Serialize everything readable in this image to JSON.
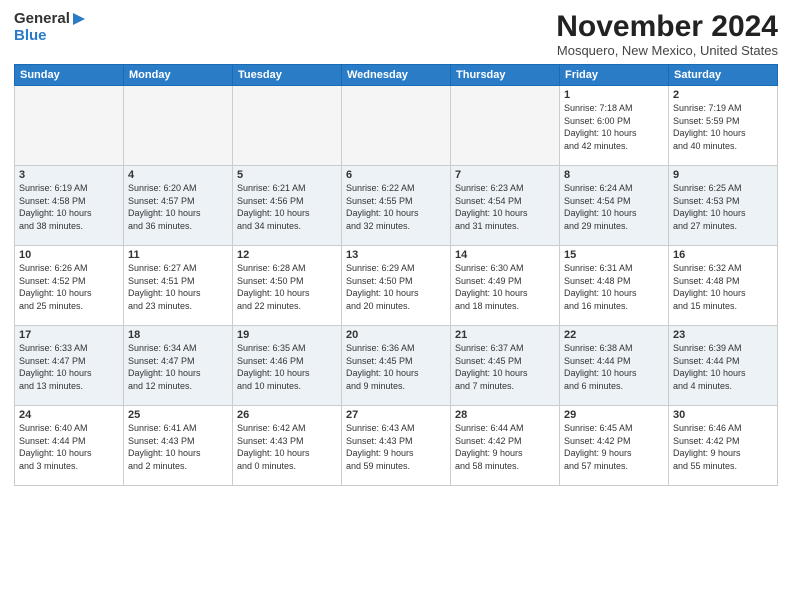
{
  "header": {
    "logo_line1": "General",
    "logo_line2": "Blue",
    "month": "November 2024",
    "location": "Mosquero, New Mexico, United States"
  },
  "weekdays": [
    "Sunday",
    "Monday",
    "Tuesday",
    "Wednesday",
    "Thursday",
    "Friday",
    "Saturday"
  ],
  "weeks": [
    [
      {
        "day": "",
        "info": ""
      },
      {
        "day": "",
        "info": ""
      },
      {
        "day": "",
        "info": ""
      },
      {
        "day": "",
        "info": ""
      },
      {
        "day": "",
        "info": ""
      },
      {
        "day": "1",
        "info": "Sunrise: 7:18 AM\nSunset: 6:00 PM\nDaylight: 10 hours\nand 42 minutes."
      },
      {
        "day": "2",
        "info": "Sunrise: 7:19 AM\nSunset: 5:59 PM\nDaylight: 10 hours\nand 40 minutes."
      }
    ],
    [
      {
        "day": "3",
        "info": "Sunrise: 6:19 AM\nSunset: 4:58 PM\nDaylight: 10 hours\nand 38 minutes."
      },
      {
        "day": "4",
        "info": "Sunrise: 6:20 AM\nSunset: 4:57 PM\nDaylight: 10 hours\nand 36 minutes."
      },
      {
        "day": "5",
        "info": "Sunrise: 6:21 AM\nSunset: 4:56 PM\nDaylight: 10 hours\nand 34 minutes."
      },
      {
        "day": "6",
        "info": "Sunrise: 6:22 AM\nSunset: 4:55 PM\nDaylight: 10 hours\nand 32 minutes."
      },
      {
        "day": "7",
        "info": "Sunrise: 6:23 AM\nSunset: 4:54 PM\nDaylight: 10 hours\nand 31 minutes."
      },
      {
        "day": "8",
        "info": "Sunrise: 6:24 AM\nSunset: 4:54 PM\nDaylight: 10 hours\nand 29 minutes."
      },
      {
        "day": "9",
        "info": "Sunrise: 6:25 AM\nSunset: 4:53 PM\nDaylight: 10 hours\nand 27 minutes."
      }
    ],
    [
      {
        "day": "10",
        "info": "Sunrise: 6:26 AM\nSunset: 4:52 PM\nDaylight: 10 hours\nand 25 minutes."
      },
      {
        "day": "11",
        "info": "Sunrise: 6:27 AM\nSunset: 4:51 PM\nDaylight: 10 hours\nand 23 minutes."
      },
      {
        "day": "12",
        "info": "Sunrise: 6:28 AM\nSunset: 4:50 PM\nDaylight: 10 hours\nand 22 minutes."
      },
      {
        "day": "13",
        "info": "Sunrise: 6:29 AM\nSunset: 4:50 PM\nDaylight: 10 hours\nand 20 minutes."
      },
      {
        "day": "14",
        "info": "Sunrise: 6:30 AM\nSunset: 4:49 PM\nDaylight: 10 hours\nand 18 minutes."
      },
      {
        "day": "15",
        "info": "Sunrise: 6:31 AM\nSunset: 4:48 PM\nDaylight: 10 hours\nand 16 minutes."
      },
      {
        "day": "16",
        "info": "Sunrise: 6:32 AM\nSunset: 4:48 PM\nDaylight: 10 hours\nand 15 minutes."
      }
    ],
    [
      {
        "day": "17",
        "info": "Sunrise: 6:33 AM\nSunset: 4:47 PM\nDaylight: 10 hours\nand 13 minutes."
      },
      {
        "day": "18",
        "info": "Sunrise: 6:34 AM\nSunset: 4:47 PM\nDaylight: 10 hours\nand 12 minutes."
      },
      {
        "day": "19",
        "info": "Sunrise: 6:35 AM\nSunset: 4:46 PM\nDaylight: 10 hours\nand 10 minutes."
      },
      {
        "day": "20",
        "info": "Sunrise: 6:36 AM\nSunset: 4:45 PM\nDaylight: 10 hours\nand 9 minutes."
      },
      {
        "day": "21",
        "info": "Sunrise: 6:37 AM\nSunset: 4:45 PM\nDaylight: 10 hours\nand 7 minutes."
      },
      {
        "day": "22",
        "info": "Sunrise: 6:38 AM\nSunset: 4:44 PM\nDaylight: 10 hours\nand 6 minutes."
      },
      {
        "day": "23",
        "info": "Sunrise: 6:39 AM\nSunset: 4:44 PM\nDaylight: 10 hours\nand 4 minutes."
      }
    ],
    [
      {
        "day": "24",
        "info": "Sunrise: 6:40 AM\nSunset: 4:44 PM\nDaylight: 10 hours\nand 3 minutes."
      },
      {
        "day": "25",
        "info": "Sunrise: 6:41 AM\nSunset: 4:43 PM\nDaylight: 10 hours\nand 2 minutes."
      },
      {
        "day": "26",
        "info": "Sunrise: 6:42 AM\nSunset: 4:43 PM\nDaylight: 10 hours\nand 0 minutes."
      },
      {
        "day": "27",
        "info": "Sunrise: 6:43 AM\nSunset: 4:43 PM\nDaylight: 9 hours\nand 59 minutes."
      },
      {
        "day": "28",
        "info": "Sunrise: 6:44 AM\nSunset: 4:42 PM\nDaylight: 9 hours\nand 58 minutes."
      },
      {
        "day": "29",
        "info": "Sunrise: 6:45 AM\nSunset: 4:42 PM\nDaylight: 9 hours\nand 57 minutes."
      },
      {
        "day": "30",
        "info": "Sunrise: 6:46 AM\nSunset: 4:42 PM\nDaylight: 9 hours\nand 55 minutes."
      }
    ]
  ]
}
